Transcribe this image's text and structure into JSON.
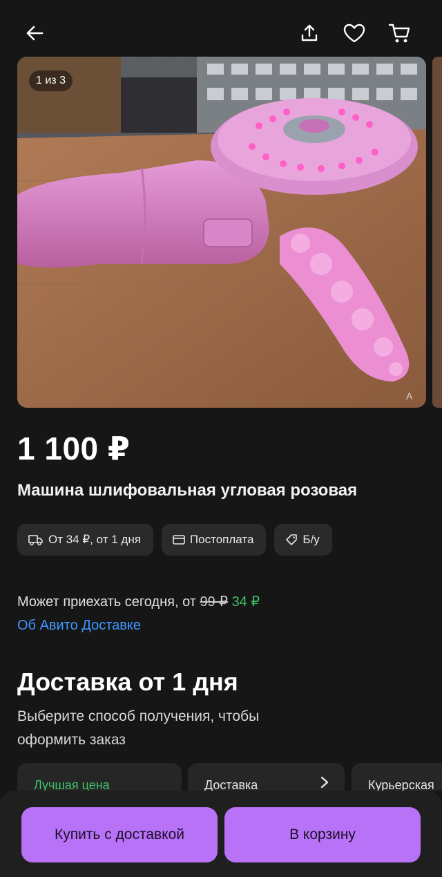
{
  "colors": {
    "background": "#161616",
    "accent": "#b872f7",
    "link": "#3f97ff",
    "success": "#3ec268",
    "chip_bg": "#2a2a2a"
  },
  "header": {
    "icons": [
      "back-arrow-icon",
      "share-icon",
      "heart-icon",
      "cart-icon"
    ]
  },
  "gallery": {
    "counter": "1 из 3",
    "watermark": "A",
    "total": 3,
    "current": 1
  },
  "product": {
    "price": "1 100 ₽",
    "title": "Машина шлифовальная угловая розовая"
  },
  "chips": [
    {
      "icon": "truck-icon",
      "label": "От 34 ₽, от 1 дня"
    },
    {
      "icon": "card-icon",
      "label": "Постоплата"
    },
    {
      "icon": "tag-icon",
      "label": "Б/у"
    }
  ],
  "delivery": {
    "text": "Может приехать сегодня, от",
    "old_price": "99 ₽",
    "new_price": "34 ₽",
    "link": "Об Авито Доставке"
  },
  "section": {
    "title": "Доставка от 1 дня",
    "description": "Выберите способ получения, чтобы оформить заказ"
  },
  "options": [
    {
      "label": "Лучшая цена"
    },
    {
      "label": "Доставка"
    },
    {
      "label": "Курьерская"
    }
  ],
  "buttons": {
    "buy": "Купить с доставкой",
    "cart": "В корзину"
  }
}
